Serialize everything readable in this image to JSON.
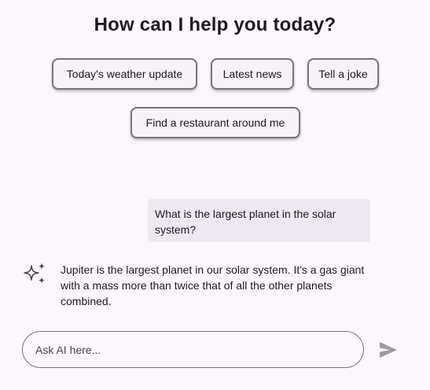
{
  "header": {
    "title": "How can I help you today?"
  },
  "suggestions": [
    {
      "label": "Today's weather update"
    },
    {
      "label": "Latest news"
    },
    {
      "label": "Tell a joke"
    },
    {
      "label": "Find a restaurant around me"
    }
  ],
  "conversation": {
    "user_message": "What is the largest planet in the solar system?",
    "ai_message": "Jupiter is the largest planet in our solar system.  It's a gas giant with a mass more than twice that of all the other planets combined.",
    "ai_icon": "sparkle-icon"
  },
  "composer": {
    "placeholder": "Ask AI here...",
    "value": "",
    "send_icon": "send-icon"
  },
  "colors": {
    "background": "#fcf7fc",
    "chip_border": "#79747e",
    "chip_fill": "#f7f2f7",
    "user_bubble": "#eee8f1",
    "text": "#1d1b20",
    "send_icon": "#9e9a9f",
    "ai_icon": "#4a4458"
  }
}
